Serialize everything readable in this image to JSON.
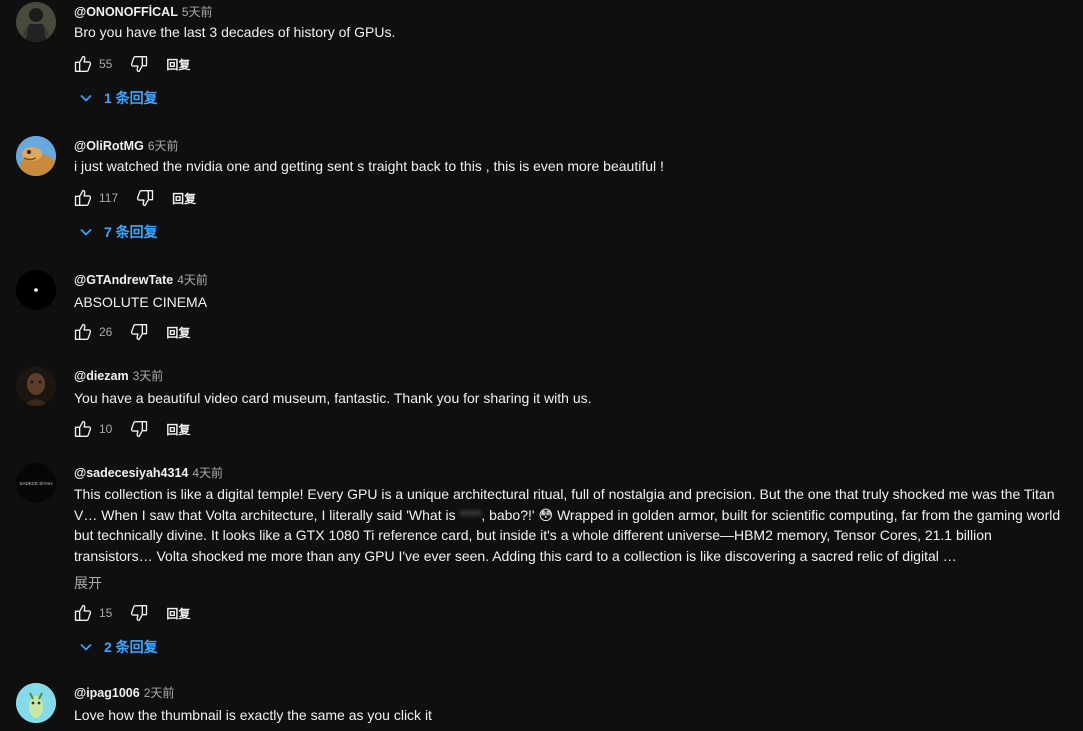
{
  "comments": [
    {
      "author": "@ONONOFFİCAL",
      "time": "5天前",
      "text": "Bro you have the last 3 decades of history of GPUs.",
      "likes": "55",
      "reply_label": "回复",
      "replies": "1 条回复",
      "avatar": "dark-helmet-figure"
    },
    {
      "author": "@OliRotMG",
      "time": "6天前",
      "text": "i just watched the nvidia one and getting sent s traight back to this , this is even more beautiful !",
      "likes": "117",
      "reply_label": "回复",
      "replies": "7 条回复",
      "avatar": "cartoon-turtle"
    },
    {
      "author": "@GTAndrewTate",
      "time": "4天前",
      "text": "ABSOLUTE CINEMA",
      "likes": "26",
      "reply_label": "回复",
      "avatar": "black-dot"
    },
    {
      "author": "@diezam",
      "time": "3天前",
      "text": "You have a beautiful video card museum, fantastic. Thank you for sharing it with us.",
      "likes": "10",
      "reply_label": "回复",
      "avatar": "dark-sculpture"
    },
    {
      "author": "@sadecesiyah4314",
      "time": "4天前",
      "text_before": "This collection is like a digital temple! Every GPU is a unique architectural ritual, full of nostalgia and precision. But the one that truly shocked me was the Titan V… When I saw that Volta architecture, I literally said 'What is ",
      "text_blur": "****",
      "text_after": ", babo?!' 😳 Wrapped in golden armor, built for scientific computing, far from the gaming world but technically divine. It looks like a GTX 1080 Ti reference card, but inside it's a whole different universe—HBM2 memory, Tensor Cores, 21.1 billion transistors… Volta shocked me more than any GPU I've ever seen. Adding this card to a collection is like discovering a sacred relic of digital …",
      "expand": "展开",
      "likes": "15",
      "reply_label": "回复",
      "replies": "2 条回复",
      "avatar": "sadece-siyah-logo"
    },
    {
      "author": "@ipag1006",
      "time": "2天前",
      "text": "Love how the thumbnail is exactly the same as you click it",
      "avatar": "cyan-character"
    }
  ],
  "colors": {
    "background": "#0f0f0f",
    "link": "#3ea6ff",
    "secondary": "#aaaaaa",
    "text": "#f1f1f1"
  },
  "icons": [
    "thumb-up-icon",
    "thumb-down-icon",
    "chevron-down-icon"
  ]
}
